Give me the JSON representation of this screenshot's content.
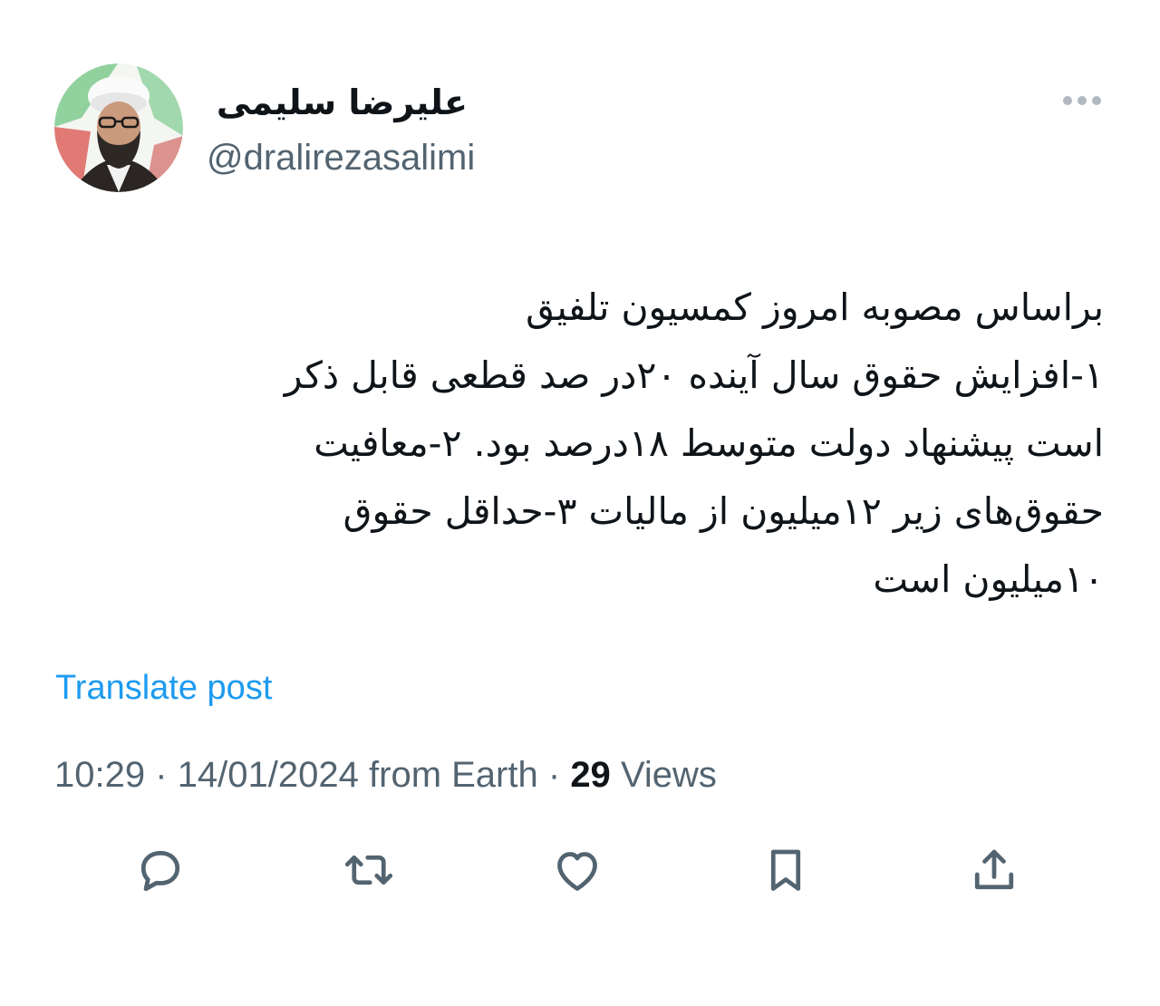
{
  "author": {
    "display_name": "علیرضا سلیمی",
    "handle": "@dralirezasalimi"
  },
  "header": {
    "more_icon": "more-horizontal-icon"
  },
  "post": {
    "lines": [
      "براساس مصوبه امروز کمسیون تلفیق",
      "۱-افزایش حقوق سال آینده ۲۰در صد قطعی قابل ذکر",
      "است پیشنهاد دولت متوسط ۱۸درصد بود. ۲-معافیت",
      "حقوق‌های زیر ۱۲میلیون از مالیات ۳-حداقل حقوق",
      "۱۰میلیون است"
    ]
  },
  "translate": {
    "label": "Translate post"
  },
  "meta": {
    "time": "10:29",
    "separator": "·",
    "date": "14/01/2024",
    "source": "from Earth",
    "views_count": "29",
    "views_label": "Views"
  },
  "actions": {
    "reply": "reply-icon",
    "repost": "repost-icon",
    "like": "like-icon",
    "bookmark": "bookmark-icon",
    "share": "share-icon"
  },
  "colors": {
    "text": "#0f1419",
    "secondary": "#536471",
    "link": "#1d9bf0",
    "icon": "#536471"
  }
}
